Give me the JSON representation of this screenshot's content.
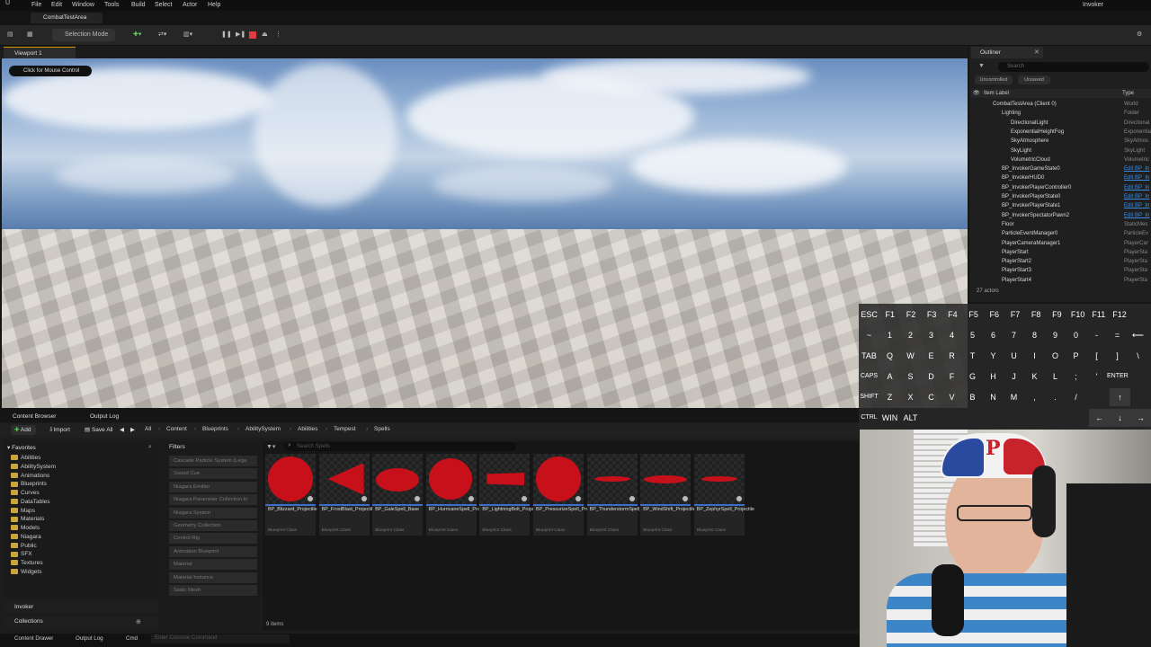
{
  "menubar": {
    "items": [
      "File",
      "Edit",
      "Window",
      "Tools",
      "Build",
      "Select",
      "Actor",
      "Help"
    ],
    "project": "Invoker"
  },
  "document_tab": "CombatTestArea",
  "toolbar": {
    "selection_mode": "Selection Mode"
  },
  "viewport": {
    "tab": "Viewport 1",
    "mouse_hint": "Click for Mouse Control"
  },
  "outliner": {
    "tab": "Outliner",
    "search_placeholder": "Search",
    "filters": [
      "Uncontrolled",
      "Unsaved"
    ],
    "col_label": "Item Label",
    "col_type": "Type",
    "rows": [
      {
        "label": "CombatTestArea (Client 0)",
        "type": "World",
        "link": false
      },
      {
        "label": "Lighting",
        "type": "Folder",
        "link": false
      },
      {
        "label": "DirectionalLight",
        "type": "Directional",
        "link": false
      },
      {
        "label": "ExponentialHeightFog",
        "type": "Exponential",
        "link": false
      },
      {
        "label": "SkyAtmosphere",
        "type": "SkyAtmos",
        "link": false
      },
      {
        "label": "SkyLight",
        "type": "SkyLight",
        "link": false
      },
      {
        "label": "VolumetricCloud",
        "type": "Volumetric",
        "link": false
      },
      {
        "label": "BP_InvokerGameState0",
        "type": "Edit BP_In",
        "link": true
      },
      {
        "label": "BP_InvokerHUD0",
        "type": "Edit BP_In",
        "link": true
      },
      {
        "label": "BP_InvokerPlayerController0",
        "type": "Edit BP_In",
        "link": true
      },
      {
        "label": "BP_InvokerPlayerState0",
        "type": "Edit BP_In",
        "link": true
      },
      {
        "label": "BP_InvokerPlayerState1",
        "type": "Edit BP_In",
        "link": true
      },
      {
        "label": "BP_InvokerSpectatorPawn2",
        "type": "Edit BP_In",
        "link": true
      },
      {
        "label": "Floor",
        "type": "StaticMes",
        "link": false
      },
      {
        "label": "ParticleEventManager0",
        "type": "ParticleEv",
        "link": false
      },
      {
        "label": "PlayerCameraManager1",
        "type": "PlayerCar",
        "link": false
      },
      {
        "label": "PlayerStart",
        "type": "PlayerSta",
        "link": false
      },
      {
        "label": "PlayerStart2",
        "type": "PlayerSta",
        "link": false
      },
      {
        "label": "PlayerStart3",
        "type": "PlayerSta",
        "link": false
      },
      {
        "label": "PlayerStart4",
        "type": "PlayerSta",
        "link": false
      }
    ],
    "count": "27 actors"
  },
  "keyboard": {
    "rows": [
      [
        "ESC",
        "F1",
        "F2",
        "F3",
        "F4",
        "F5",
        "F6",
        "F7",
        "F8",
        "F9",
        "F10",
        "F11",
        "F12"
      ],
      [
        "~",
        "1",
        "2",
        "3",
        "4",
        "5",
        "6",
        "7",
        "8",
        "9",
        "0",
        "-",
        "=",
        "⟵"
      ],
      [
        "TAB",
        "Q",
        "W",
        "E",
        "R",
        "T",
        "Y",
        "U",
        "I",
        "O",
        "P",
        "[",
        "]",
        "\\"
      ],
      [
        "CAPS",
        "A",
        "S",
        "D",
        "F",
        "G",
        "H",
        "J",
        "K",
        "L",
        ";",
        "'",
        "ENTER"
      ],
      [
        "SHIFT",
        "Z",
        "X",
        "C",
        "V",
        "B",
        "N",
        "M",
        ",",
        ".",
        "/",
        "↑"
      ],
      [
        "CTRL",
        "WIN",
        "ALT",
        "←",
        "↓",
        "→"
      ]
    ]
  },
  "content_browser": {
    "tab": "Content Browser",
    "output_tab": "Output Log",
    "add": "Add",
    "import": "Import",
    "save_all": "Save All",
    "breadcrumb": [
      "All",
      "Content",
      "Blueprints",
      "AbilitySystem",
      "Abilities",
      "Tempest",
      "Spells"
    ],
    "favorites": "Favorites",
    "folders": [
      "Abilities",
      "AbilitySystem",
      "Animations",
      "Blueprints",
      "Curves",
      "DataTables",
      "Maps",
      "Materials",
      "Models",
      "Niagara",
      "Public",
      "SFX",
      "Textures",
      "Widgets"
    ],
    "invoker_section": "Invoker",
    "collections_section": "Collections",
    "filters_title": "Filters",
    "filter_items": [
      "Cascade Particle System (Lega",
      "Sound Cue",
      "Niagara Emitter",
      "Niagara Parameter Collection In",
      "Niagara System",
      "Geometry Collection",
      "Control Rig",
      "Animation Blueprint",
      "Material",
      "Material Instance",
      "Static Mesh"
    ],
    "search_placeholder": "Search Spells",
    "assets": [
      {
        "name": "BP_Blizzard_Projectile",
        "cls": "Blueprint Class",
        "shape": "circle"
      },
      {
        "name": "BP_FrostBlast_Projectile",
        "cls": "Blueprint Class",
        "shape": "cone"
      },
      {
        "name": "BP_GaleSpell_Base",
        "cls": "Blueprint Class",
        "shape": "ellipse"
      },
      {
        "name": "BP_HurricaneSpell_Projectile",
        "cls": "Blueprint Class",
        "shape": "circle-wide"
      },
      {
        "name": "BP_LightningBolt_Projectile",
        "cls": "Blueprint Class",
        "shape": "rect"
      },
      {
        "name": "BP_PressurizeSpell_Projectile",
        "cls": "Blueprint Class",
        "shape": "circle"
      },
      {
        "name": "BP_ThunderstormSpell_Projectile",
        "cls": "Blueprint Class",
        "shape": "thin"
      },
      {
        "name": "BP_WindShift_Projectile",
        "cls": "Blueprint Class",
        "shape": "flat"
      },
      {
        "name": "BP_ZephyrSpell_Projectile",
        "cls": "Blueprint Class",
        "shape": "thin"
      }
    ],
    "item_count": "9 items"
  },
  "bottom_bar": {
    "content_drawer": "Content Drawer",
    "output_log": "Output Log",
    "cmd": "Cmd",
    "console_placeholder": "Enter Console Command"
  },
  "colors": {
    "accent": "#d29600",
    "asset_red": "#c8101a",
    "link": "#3a8ee6"
  }
}
